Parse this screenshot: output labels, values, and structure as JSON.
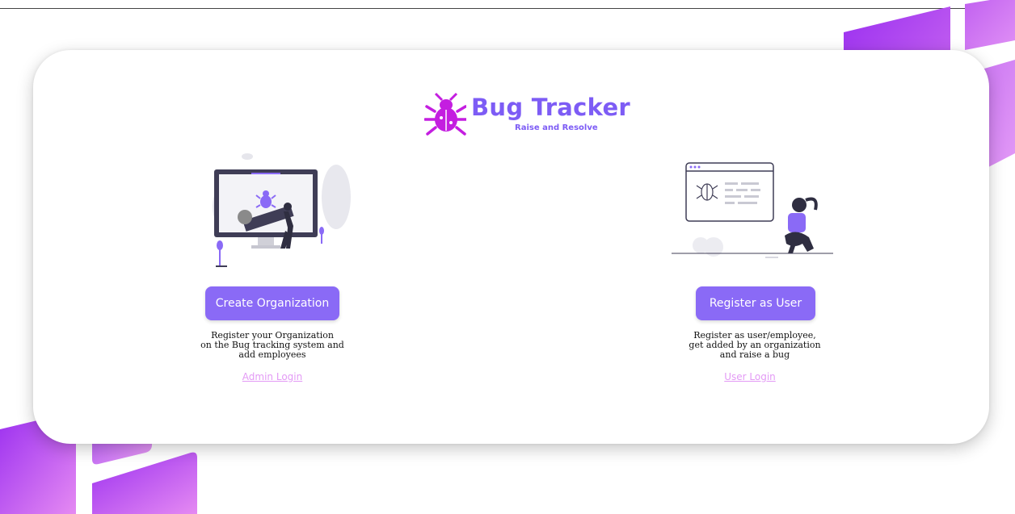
{
  "brand": {
    "title": "Bug Tracker",
    "subtitle": "Raise and Resolve",
    "icon": "bug-icon"
  },
  "organization": {
    "button_label": "Create Organization",
    "description": [
      "Register your Organization",
      "on the Bug tracking system and",
      "add employees"
    ],
    "login_link": "Admin Login"
  },
  "user": {
    "button_label": "Register as User",
    "description": [
      "Register as user/employee,",
      "get added by an organization",
      "and raise a bug"
    ],
    "login_link": "User Login"
  },
  "colors": {
    "primary": "#8a6af6",
    "brand_text": "#7d5cf5",
    "bug_magenta": "#c41ee0",
    "link": "#e39af5",
    "decor_purple": "#a53cf0",
    "decor_pink": "#d77af0"
  }
}
